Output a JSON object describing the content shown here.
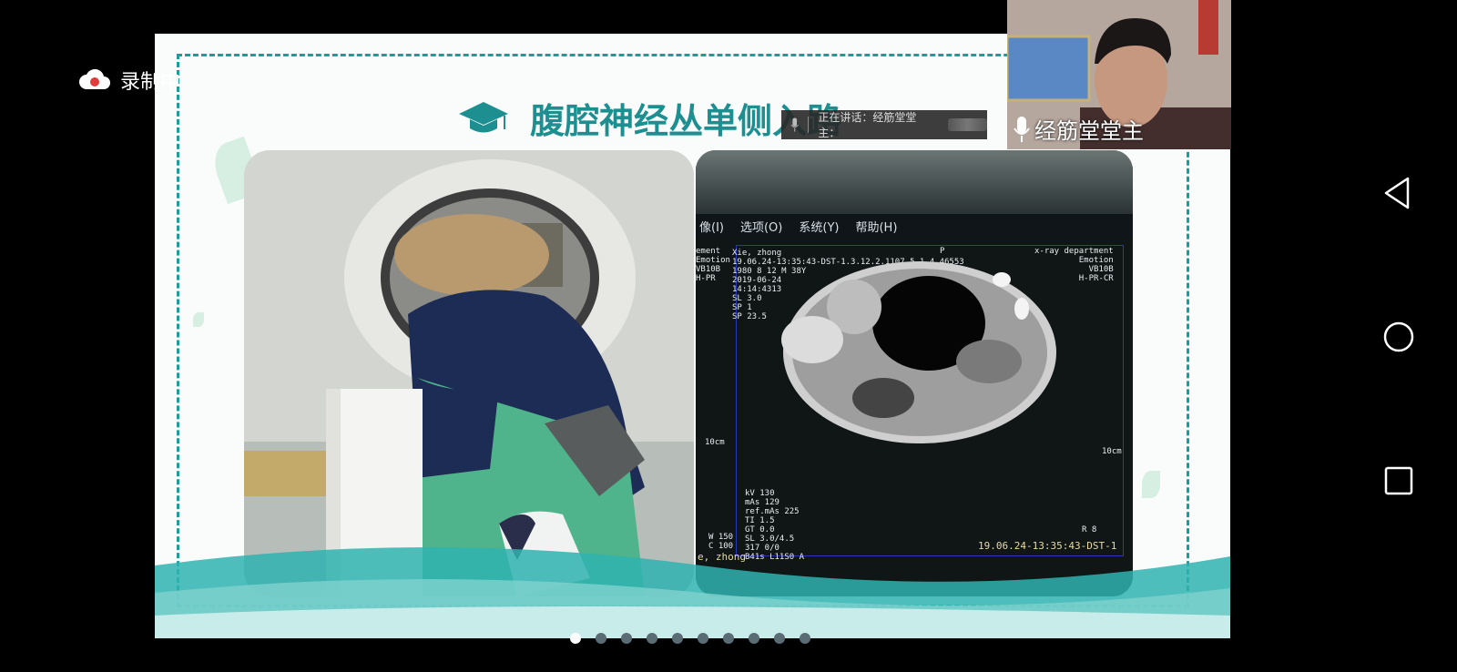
{
  "recording": {
    "label": "录制中"
  },
  "slide": {
    "title": "腹腔神经丛单侧入路"
  },
  "speaking": {
    "label": "正在讲话：经筋堂堂主："
  },
  "webcam": {
    "name": "经筋堂堂主"
  },
  "ct": {
    "menu": [
      "像(I)",
      "选项(O)",
      "系统(Y)",
      "帮助(H)"
    ],
    "header_left": "ement\nEmotion\nVB10B\nH-PR",
    "patient": "Xie, zhong\n19.06.24-13:35:43-DST-1.3.12.2.1107.5.1.4.46553\n1980 8 12 M 38Y\n2019-06-24\n14:14:4313\nSL 3.0\nSP 1\nSP 23.5",
    "marker_p": "P",
    "header_right": "x-ray department\nEmotion\nVB10B\nH-PR-CR",
    "scale_left": "10cm",
    "scale_right": "10cm",
    "params": "kV 130\nmAs 129\nref.mAs 225\nTI 1.5\nGT 0.0\nSL 3.0/4.5\n317 0/0\nB41s L11S0 A",
    "window_left": "W 150\nC 100",
    "window_right": "R 8",
    "footer_left": "e, zhong",
    "footer_right": "19.06.24-13:35:43-DST-1"
  },
  "pager": {
    "count": 10,
    "active": 0
  },
  "colors": {
    "accent": "#1d8f90",
    "border": "#1f9c97",
    "wave": "#2fb3b0"
  }
}
